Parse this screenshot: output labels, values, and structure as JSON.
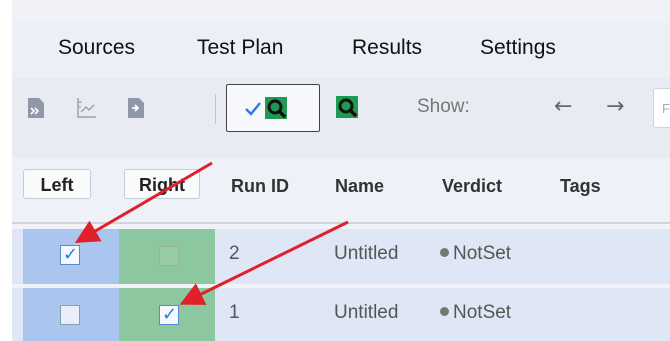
{
  "menu": [
    "Sources",
    "Test Plan",
    "Results",
    "Settings"
  ],
  "toolbar": {
    "show_label": "Show:",
    "icons": [
      "import-icon",
      "chart-axes-icon",
      "export-icon",
      "filter-check-icon",
      "search-icon",
      "back-arrow-icon",
      "forward-arrow-icon"
    ],
    "back_glyph": "←",
    "forward_glyph": "→",
    "search_edge_char": "F"
  },
  "table": {
    "headers": [
      "Left",
      "Right",
      "Run ID",
      "Name",
      "Verdict",
      "Tags"
    ],
    "rows": [
      {
        "left_checked": true,
        "right_checked": false,
        "run_id": "2",
        "name": "Untitled",
        "verdict": "NotSet",
        "tags": ""
      },
      {
        "left_checked": false,
        "right_checked": true,
        "run_id": "1",
        "name": "Untitled",
        "verdict": "NotSet",
        "tags": ""
      }
    ]
  },
  "colors": {
    "left_column": "#aac6ef",
    "right_column": "#8cc79f",
    "annotation_arrow": "#e0202a",
    "row_background": "#dfe6f5"
  }
}
